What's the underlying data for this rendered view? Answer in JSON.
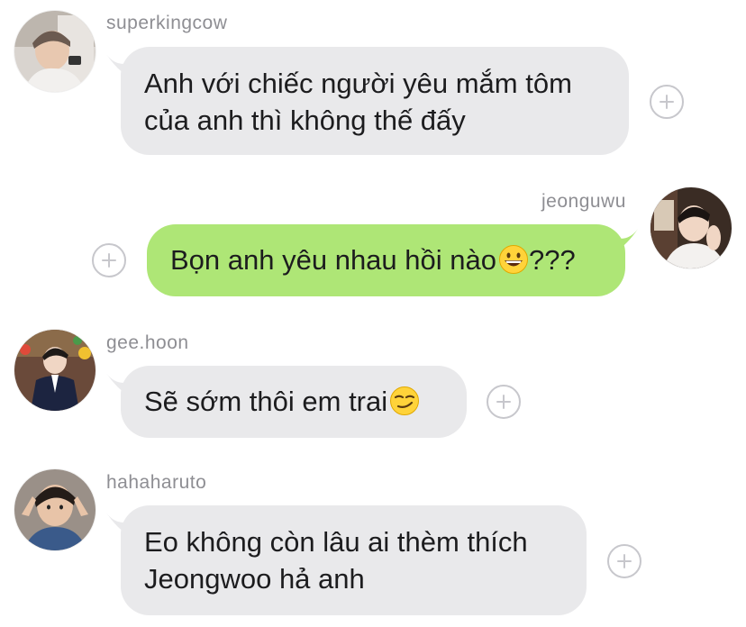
{
  "colors": {
    "incoming_bubble": "#e9e9eb",
    "outgoing_bubble": "#aee676",
    "username": "#8e8e93",
    "react_button_border": "#c7c7cc"
  },
  "messages": [
    {
      "username": "superkingcow",
      "direction": "incoming",
      "text": "Anh với chiếc người yêu mắm tôm\ncủa anh thì không thế đấy",
      "emoji": null,
      "avatar_icon": "profile-photo-icon"
    },
    {
      "username": "jeonguwu",
      "direction": "outgoing",
      "text": "Bọn anh yêu nhau hồi nào",
      "emoji": "grinning-face-emoji",
      "text_after": "???",
      "avatar_icon": "profile-photo-icon"
    },
    {
      "username": "gee.hoon",
      "direction": "incoming",
      "text": "Sẽ sớm thôi em trai",
      "emoji": "smirking-face-emoji",
      "avatar_icon": "profile-photo-icon"
    },
    {
      "username": "hahaharuto",
      "direction": "incoming",
      "text": "Eo không còn lâu ai thèm thích\nJeongwoo hả anh",
      "emoji": null,
      "avatar_icon": "profile-photo-icon"
    }
  ],
  "react_button_icon": "plus-circle-icon"
}
